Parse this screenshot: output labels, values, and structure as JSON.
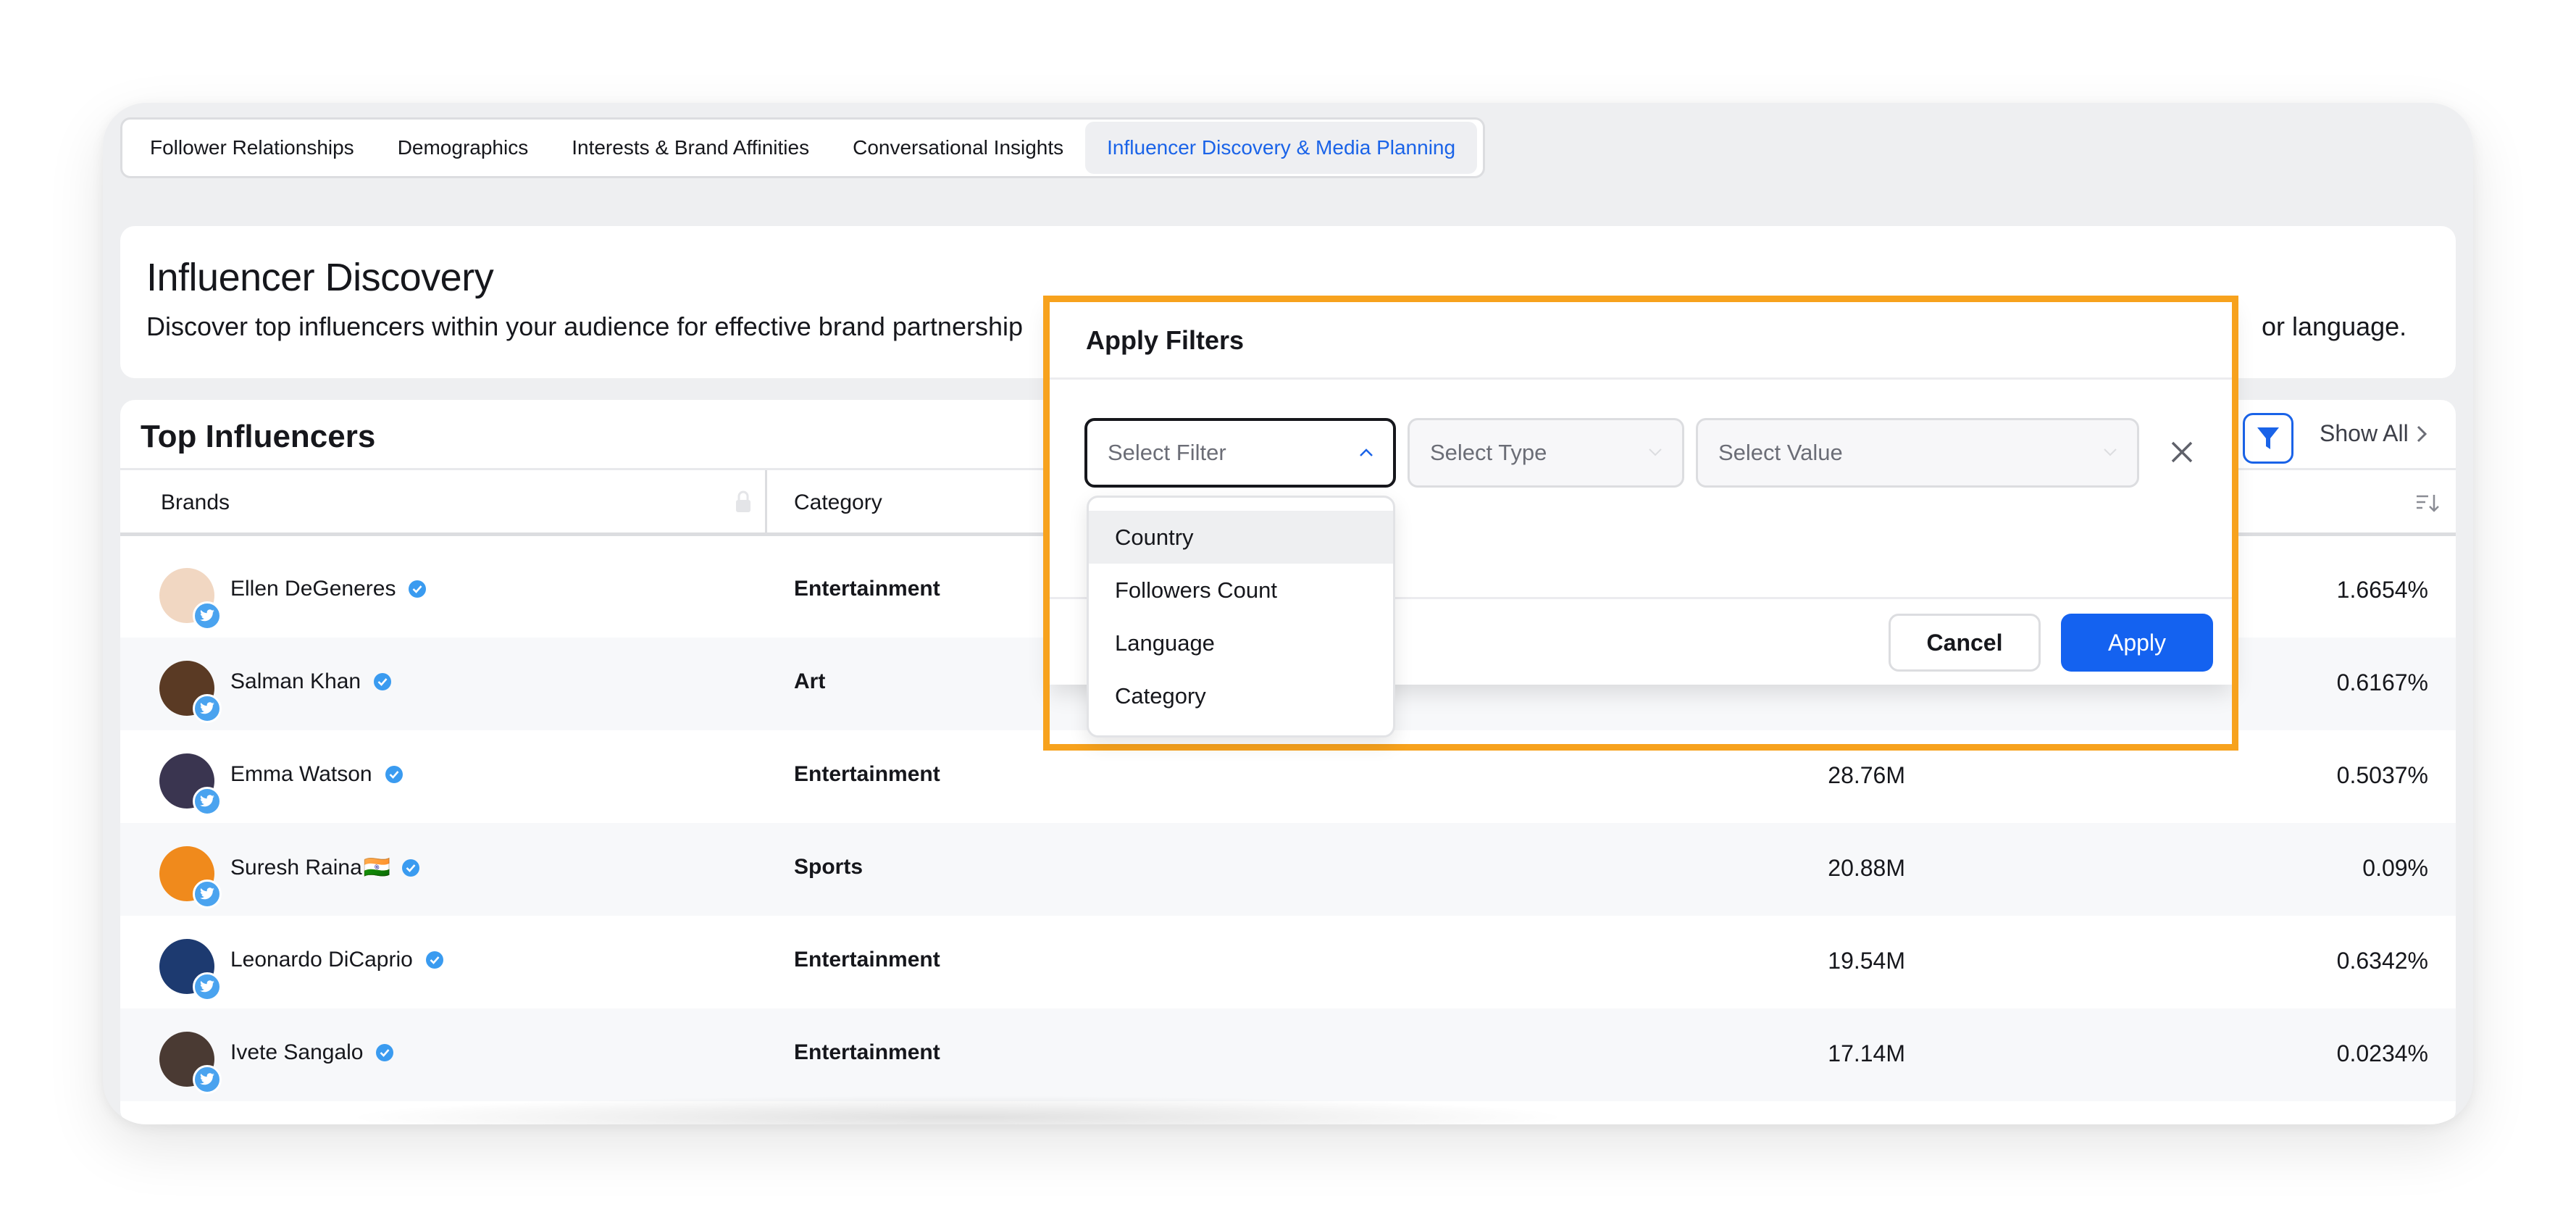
{
  "tabs": [
    {
      "label": "Follower Relationships",
      "active": false
    },
    {
      "label": "Demographics",
      "active": false
    },
    {
      "label": "Interests & Brand Affinities",
      "active": false
    },
    {
      "label": "Conversational Insights",
      "active": false
    },
    {
      "label": "Influencer Discovery & Media Planning",
      "active": true
    }
  ],
  "header": {
    "title": "Influencer Discovery",
    "description_visible_start": "Discover top influencers within your audience for effective brand partnership",
    "description_visible_end": "or language."
  },
  "table": {
    "title": "Top Influencers",
    "show_all_label": "Show All",
    "columns": [
      "Brands",
      "Category"
    ],
    "rows": [
      {
        "name": "Ellen DeGeneres",
        "flag": "",
        "category": "Entertainment",
        "followers": "",
        "rate": "1.6654%",
        "avatar_color": "#f1d7c2"
      },
      {
        "name": "Salman Khan",
        "flag": "",
        "category": "Art",
        "followers": "",
        "rate": "0.6167%",
        "avatar_color": "#5a3a24"
      },
      {
        "name": "Emma Watson",
        "flag": "",
        "category": "Entertainment",
        "followers": "28.76M",
        "rate": "0.5037%",
        "avatar_color": "#3a3550"
      },
      {
        "name": "Suresh Raina",
        "flag": "🇮🇳",
        "category": "Sports",
        "followers": "20.88M",
        "rate": "0.09%",
        "avatar_color": "#f08a1c"
      },
      {
        "name": "Leonardo DiCaprio",
        "flag": "",
        "category": "Entertainment",
        "followers": "19.54M",
        "rate": "0.6342%",
        "avatar_color": "#1d3a70"
      },
      {
        "name": "Ivete Sangalo",
        "flag": "",
        "category": "Entertainment",
        "followers": "17.14M",
        "rate": "0.0234%",
        "avatar_color": "#4a3a33"
      }
    ]
  },
  "modal": {
    "title": "Apply Filters",
    "filter_placeholder": "Select Filter",
    "type_placeholder": "Select Type",
    "value_placeholder": "Select Value",
    "cancel_label": "Cancel",
    "apply_label": "Apply",
    "dropdown_options": [
      "Country",
      "Followers Count",
      "Language",
      "Category"
    ],
    "highlight_color": "#f7a21d"
  },
  "colors": {
    "accent": "#1a63e8",
    "twitter": "#4aa3ef",
    "verified": "#3a9bf0"
  }
}
